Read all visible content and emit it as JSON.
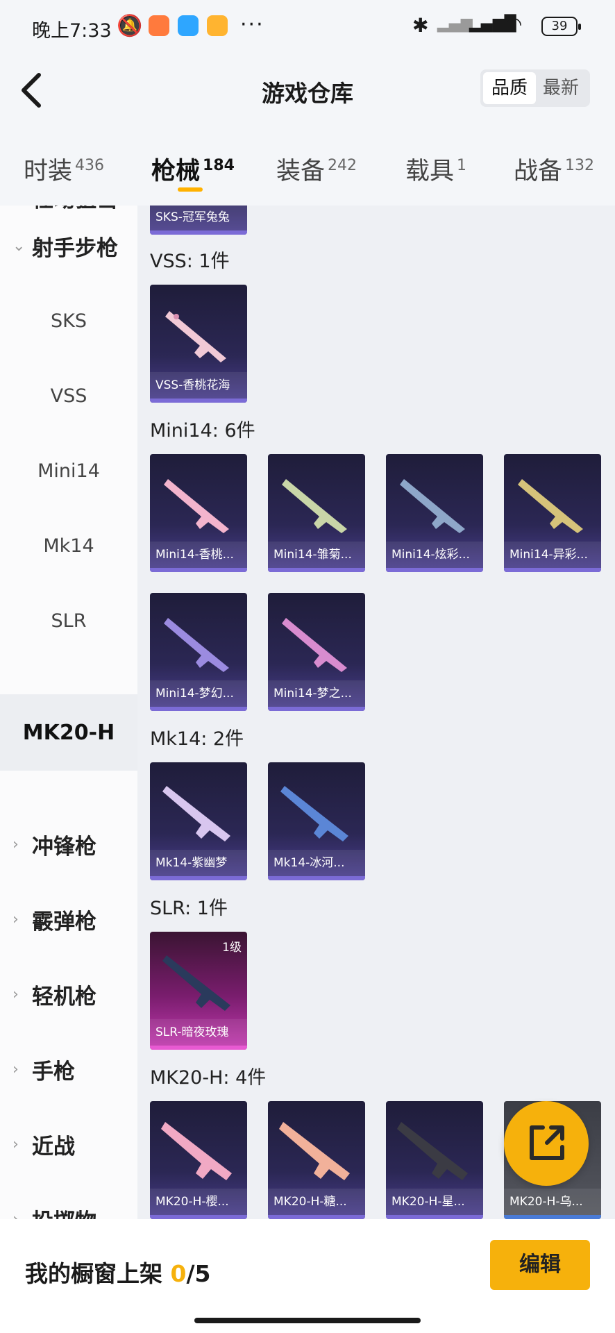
{
  "status_bar": {
    "time": "晚上7:33",
    "battery": "39"
  },
  "header": {
    "title": "游戏仓库",
    "sort_options": [
      "品质",
      "最新"
    ],
    "active_sort": "品质"
  },
  "tabs": [
    {
      "label": "时装",
      "count": "436"
    },
    {
      "label": "枪械",
      "count": "184",
      "active": true
    },
    {
      "label": "装备",
      "count": "242"
    },
    {
      "label": "载具",
      "count": "1"
    },
    {
      "label": "战备",
      "count": "132"
    }
  ],
  "sidebar": {
    "partial_top": "栓动狙击",
    "category_open": "射手步枪",
    "subitems": [
      "SKS",
      "VSS",
      "Mini14",
      "Mk14",
      "SLR",
      "MK20-H"
    ],
    "selected": "MK20-H",
    "categories": [
      "冲锋枪",
      "霰弹枪",
      "轻机枪",
      "手枪",
      "近战",
      "投掷物"
    ]
  },
  "content": {
    "partial_card_label": "SKS-冠军兔兔",
    "sections": [
      {
        "title": "VSS: 1件",
        "items": [
          {
            "name": "VSS-香桃花海"
          }
        ]
      },
      {
        "title": "Mini14: 6件",
        "items": [
          {
            "name": "Mini14-香桃..."
          },
          {
            "name": "Mini14-雏菊..."
          },
          {
            "name": "Mini14-炫彩..."
          },
          {
            "name": "Mini14-异彩..."
          },
          {
            "name": "Mini14-梦幻..."
          },
          {
            "name": "Mini14-梦之..."
          }
        ]
      },
      {
        "title": "Mk14: 2件",
        "items": [
          {
            "name": "Mk14-紫幽梦"
          },
          {
            "name": "Mk14-冰河..."
          }
        ]
      },
      {
        "title": "SLR: 1件",
        "items": [
          {
            "name": "SLR-暗夜玫瑰",
            "level": "1级"
          }
        ]
      },
      {
        "title": "MK20-H: 4件",
        "items": [
          {
            "name": "MK20-H-樱..."
          },
          {
            "name": "MK20-H-糖..."
          },
          {
            "name": "MK20-H-星..."
          },
          {
            "name": "MK20-H-乌..."
          }
        ]
      }
    ]
  },
  "bottom": {
    "label": "我的橱窗上架 ",
    "count": "0",
    "total": "/5",
    "edit_button": "编辑"
  },
  "colors": {
    "accent": "#f6b10c",
    "card_bg": "#2b2754",
    "card_rare": "#c33bb0"
  }
}
